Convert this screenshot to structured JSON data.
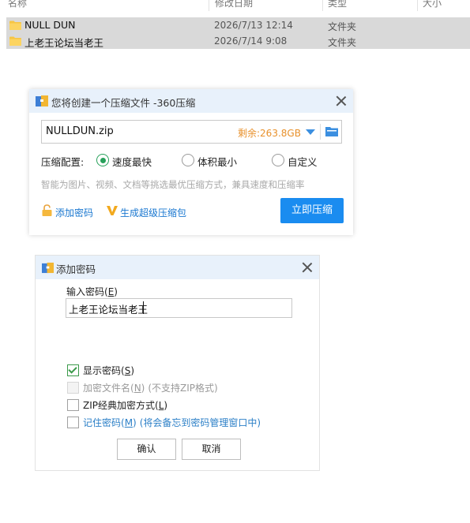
{
  "explorer": {
    "columns": [
      "名称",
      "修改日期",
      "类型",
      "大小"
    ],
    "rows": [
      {
        "name": "NULL DUN",
        "date": "2026/7/13 12:14",
        "type": "文件夹"
      },
      {
        "name": "上老王论坛当老王",
        "date": "2026/7/14 9:08",
        "type": "文件夹"
      }
    ]
  },
  "compress_dialog": {
    "title": "您将创建一个压缩文件 -360压缩",
    "filename": "NULLDUN.zip",
    "free_space": "剩余:263.8GB",
    "config_label": "压缩配置:",
    "options": [
      "速度最快",
      "体积最小",
      "自定义"
    ],
    "selected_option": "速度最快",
    "hint": "智能为图片、视频、文档等挑选最优压缩方式，兼具速度和压缩率",
    "add_password_link": "添加密码",
    "super_pkg_link": "生成超级压缩包",
    "compress_button": "立即压缩"
  },
  "password_dialog": {
    "title": "添加密码",
    "input_label": "输入密码(",
    "input_label_key": "E",
    "input_label_end": ")",
    "password_value": "上老王论坛当老王",
    "show_password": {
      "label": "显示密码(",
      "key": "S",
      "end": ")",
      "checked": true
    },
    "encrypt_filename": {
      "label": "加密文件名(",
      "key": "N",
      "end": ")",
      "note": "(不支持ZIP格式)",
      "checked": false,
      "disabled": true
    },
    "zip_classic": {
      "label": "ZIP经典加密方式(",
      "key": "L",
      "end": ")",
      "checked": false
    },
    "remember": {
      "label": "记住密码(",
      "key": "M",
      "end": ")",
      "note": "(将会备忘到密码管理窗口中)",
      "checked": false
    },
    "ok_button": "确认",
    "cancel_button": "取消"
  },
  "colors": {
    "accent": "#1a8cf0",
    "title_bar": "#e8f1fb",
    "free_space": "#e8912c",
    "check_green": "#27a05a",
    "link_blue": "#1b78d0",
    "row_selected": "#d9d9d9"
  },
  "icons": {
    "folder": "folder-icon",
    "app": "360-zip-icon",
    "dropdown": "chevron-down-icon",
    "browse": "folder-browse-icon",
    "lock": "lock-icon",
    "vip": "v-badge-icon",
    "close": "close-icon"
  }
}
